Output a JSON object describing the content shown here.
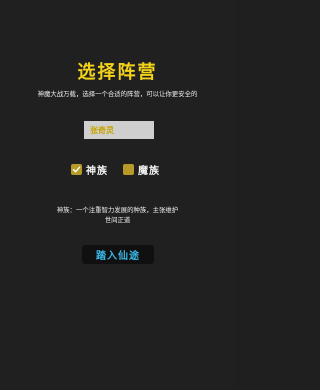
{
  "page": {
    "title": "选择阵营",
    "subtitle": "神魔大战万载，选择一个合适的阵营，可以让你更安全的"
  },
  "name_field": {
    "placeholder": "张奇灵"
  },
  "factions": {
    "options": [
      {
        "label": "神族",
        "checked": true
      },
      {
        "label": "魔族",
        "checked": false
      }
    ]
  },
  "description": {
    "line1": "神族：一个注重智力发展的种族，主张维护",
    "line2": "世间正道"
  },
  "enter_button": {
    "label": "踏入仙途"
  },
  "colors": {
    "background": "#202020",
    "title": "#f3d21a",
    "checkbox": "#b89a28",
    "button_text": "#3ab8e8"
  },
  "icons": {
    "checked": "check-icon"
  }
}
